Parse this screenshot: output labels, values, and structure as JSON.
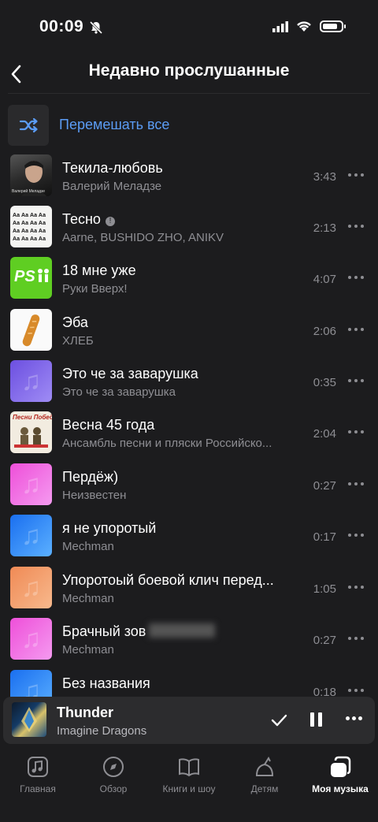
{
  "status": {
    "time": "00:09"
  },
  "header": {
    "title": "Недавно прослушанные"
  },
  "shuffle": {
    "label": "Перемешать все"
  },
  "tracks": [
    {
      "title": "Текила-любовь",
      "artist": "Валерий Меладзе",
      "duration": "3:43"
    },
    {
      "title": "Тесно",
      "artist": "Aarne, BUSHIDO ZHO, ANIKV",
      "duration": "2:13",
      "explicit_badge": "!"
    },
    {
      "title": "18 мне уже",
      "artist": "Руки Вверх!",
      "duration": "4:07"
    },
    {
      "title": "Эба",
      "artist": "ХЛЕБ",
      "duration": "2:06"
    },
    {
      "title": "Это че за заварушка",
      "artist": "Это че за заварушка",
      "duration": "0:35"
    },
    {
      "title": "Весна 45 года",
      "artist": "Ансамбль песни и пляски Российско...",
      "duration": "2:04"
    },
    {
      "title": "Пердёж)",
      "artist": "Неизвестен",
      "duration": "0:27"
    },
    {
      "title": "я не упоротый",
      "artist": "Mechman",
      "duration": "0:17"
    },
    {
      "title": "Упоротоый боевой клич перед...",
      "artist": "Mechman",
      "duration": "1:05"
    },
    {
      "title": "Брачный зов",
      "artist": "Mechman",
      "duration": "0:27"
    },
    {
      "title": "Без названия",
      "artist": "",
      "duration": "0:18"
    }
  ],
  "covers": {
    "album_1_caption": "Валерий Меладзе",
    "album_2_text": "Аа Аа Аа Аа",
    "album_3_text": "PS",
    "album_6_text": "Песни Победы"
  },
  "player": {
    "title": "Thunder",
    "artist": "Imagine Dragons"
  },
  "tabs": [
    {
      "label": "Главная",
      "icon": "note-icon"
    },
    {
      "label": "Обзор",
      "icon": "compass-icon"
    },
    {
      "label": "Книги и шоу",
      "icon": "book-icon"
    },
    {
      "label": "Детям",
      "icon": "kids-icon"
    },
    {
      "label": "Моя музыка",
      "icon": "my-music-icon",
      "active": true
    }
  ],
  "colors": {
    "background": "#1c1c1e",
    "accent": "#5b9cf5",
    "secondary_text": "#8e8e93"
  }
}
